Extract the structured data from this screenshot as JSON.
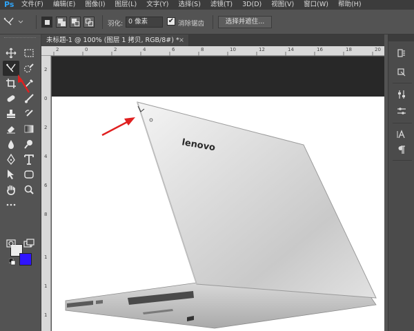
{
  "app": {
    "logo": "Ps"
  },
  "menu": [
    "文件(F)",
    "编辑(E)",
    "图像(I)",
    "图层(L)",
    "文字(Y)",
    "选择(S)",
    "滤镜(T)",
    "3D(D)",
    "视图(V)",
    "窗口(W)",
    "帮助(H)"
  ],
  "options": {
    "feather_label": "羽化:",
    "feather_value": "0 像素",
    "antialias_label": "消除锯齿",
    "antialias_checked": "✔",
    "select_mask_button": "选择并遮住..."
  },
  "document": {
    "tab_title": "未标题-1 @ 100% (图层 1 拷贝, RGB/8#) *",
    "tab_close": "×"
  },
  "rulers": {
    "top": [
      "2",
      "0",
      "2",
      "4",
      "6",
      "8",
      "10",
      "12",
      "14",
      "16",
      "18",
      "20"
    ],
    "left": [
      "2",
      "0",
      "2",
      "4",
      "6",
      "8",
      "1",
      "1",
      "1"
    ]
  },
  "canvas": {
    "brand": "lenovo",
    "image": "laptop-photo"
  },
  "colors": {
    "foreground": "#ececec",
    "background": "#2f14ff",
    "annotation_arrow": "#e02020"
  }
}
